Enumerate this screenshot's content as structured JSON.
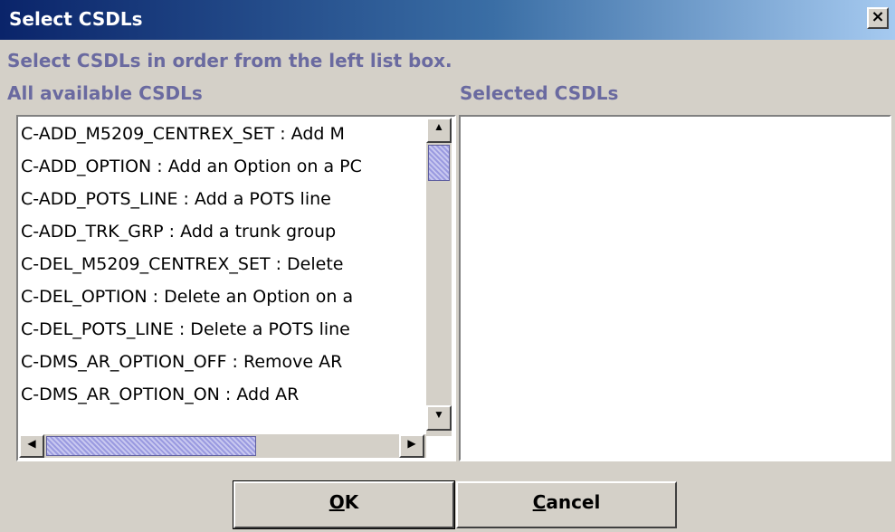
{
  "window": {
    "title": "Select CSDLs",
    "close_label": "×",
    "instruction": "Select CSDLs in order from the left list box.",
    "title_gradient_start": "#0a246a",
    "title_gradient_end": "#a6caf0"
  },
  "left": {
    "label": "All available CSDLs",
    "items": [
      "C-ADD_M5209_CENTREX_SET : Add M",
      "C-ADD_OPTION : Add an Option on a PC",
      "C-ADD_POTS_LINE : Add a POTS line",
      "C-ADD_TRK_GRP : Add a trunk group",
      "C-DEL_M5209_CENTREX_SET : Delete",
      "C-DEL_OPTION : Delete an Option on a",
      "C-DEL_POTS_LINE : Delete a POTS line",
      "C-DMS_AR_OPTION_OFF : Remove AR",
      "C-DMS_AR_OPTION_ON : Add AR"
    ],
    "scroll": {
      "up_icon": "▲",
      "down_icon": "▼",
      "left_icon": "◀",
      "right_icon": "▶"
    }
  },
  "right": {
    "label": "Selected CSDLs",
    "items": []
  },
  "buttons": {
    "ok_mnemonic": "O",
    "ok_rest": "K",
    "cancel_mnemonic": "C",
    "cancel_rest": "ancel"
  },
  "colors": {
    "accent_label": "#6a6aa0",
    "dialog_bg": "#d4d0c8",
    "scroll_thumb": "#9a9ae0"
  }
}
